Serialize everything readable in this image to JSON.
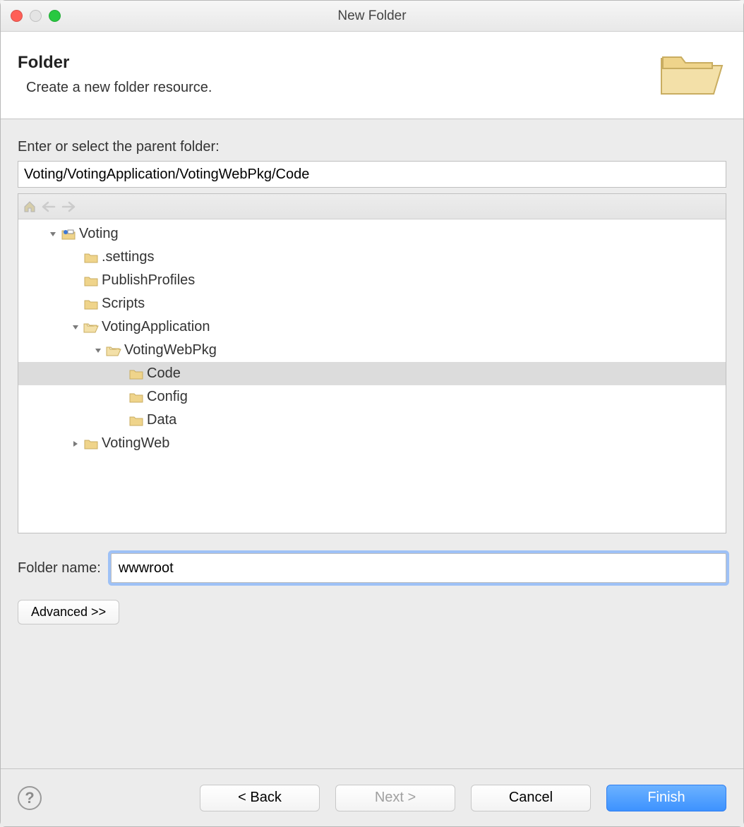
{
  "window": {
    "title": "New Folder"
  },
  "banner": {
    "heading": "Folder",
    "subtext": "Create a new folder resource."
  },
  "parent": {
    "label": "Enter or select the parent folder:",
    "value": "Voting/VotingApplication/VotingWebPkg/Code"
  },
  "tree": {
    "root": {
      "label": "Voting",
      "type": "project",
      "expanded": true,
      "children": [
        {
          "label": ".settings",
          "type": "folder"
        },
        {
          "label": "PublishProfiles",
          "type": "folder"
        },
        {
          "label": "Scripts",
          "type": "folder"
        },
        {
          "label": "VotingApplication",
          "type": "folder",
          "expanded": true,
          "children": [
            {
              "label": "VotingWebPkg",
              "type": "folder",
              "expanded": true,
              "children": [
                {
                  "label": "Code",
                  "type": "folder",
                  "selected": true
                },
                {
                  "label": "Config",
                  "type": "folder"
                },
                {
                  "label": "Data",
                  "type": "folder"
                }
              ]
            }
          ]
        },
        {
          "label": "VotingWeb",
          "type": "folder",
          "expanded": false,
          "hasChildren": true
        }
      ]
    }
  },
  "folderName": {
    "label": "Folder name:",
    "value": "wwwroot"
  },
  "advanced": {
    "label": "Advanced >>"
  },
  "buttons": {
    "back": "< Back",
    "next": "Next >",
    "cancel": "Cancel",
    "finish": "Finish"
  }
}
